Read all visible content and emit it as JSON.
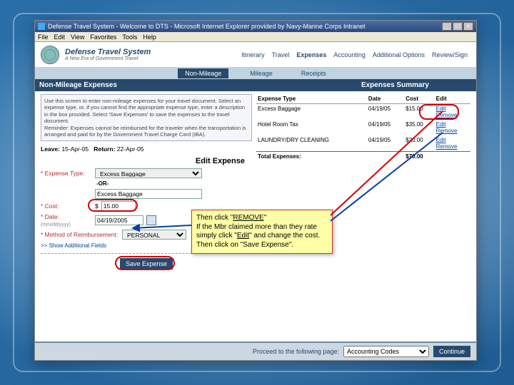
{
  "window": {
    "title": "Defense Travel System - Welcome to DTS - Microsoft Internet Explorer provided by Navy-Marine Corps Intranet",
    "min": "_",
    "max": "□",
    "close": "×"
  },
  "menu": {
    "file": "File",
    "edit": "Edit",
    "view": "View",
    "fav": "Favorites",
    "tools": "Tools",
    "help": "Help"
  },
  "brand": {
    "title": "Defense Travel System",
    "sub": "A New Era of Government Travel"
  },
  "tabs": {
    "itin": "Itinerary",
    "travel": "Travel",
    "expenses": "Expenses",
    "acct": "Accounting",
    "addl": "Additional Options",
    "review": "Review/Sign"
  },
  "subtabs": {
    "nm": "Non-Mileage",
    "mi": "Mileage",
    "rc": "Receipts"
  },
  "section": {
    "left": "Non-Mileage Expenses",
    "right": "Expenses Summary"
  },
  "instr": "Use this screen to enter non-mileage expenses for your travel document. Select an expense type, or, if you cannot find the appropriate expense type, enter a description in the box provided. Select 'Save Expenses' to save the expenses to the travel document.\nReminder: Expenses cannot be reimbursed for the traveler when the transportation is arranged and paid for by the Government Travel Charge Card (IBA).",
  "lr": {
    "leave_l": "Leave:",
    "leave_d": "15-Apr-05",
    "ret_l": "Return:",
    "ret_d": "22-Apr-05"
  },
  "editexp": "Edit Expense",
  "form": {
    "type_l": "* Expense Type:",
    "type_v": "Excess Baggage",
    "or": "-OR-",
    "desc_v": "Excess Baggage",
    "cost_l": "* Cost:",
    "cost_v": "15.00",
    "date_l": "* Date:",
    "date_hint": "(mm/dd/yyyy)",
    "date_v": "04/19/2005",
    "mor_l": "* Method of Reimbursement:",
    "mor_v": "PERSONAL",
    "more": ">> Show Additional Fields",
    "save": "Save Expense"
  },
  "summary": {
    "h1": "Expense Type",
    "h2": "Date",
    "h3": "Cost",
    "h4": "Edit",
    "rows": [
      {
        "t": "Excess Baggage",
        "d": "04/19/05",
        "c": "$15.00",
        "e": "Edit",
        "r": "Remove"
      },
      {
        "t": "Hotel Room Tax",
        "d": "04/19/05",
        "c": "$35.00",
        "e": "Edit",
        "r": "Remove"
      },
      {
        "t": "LAUNDRY/DRY CLEANING",
        "d": "04/19/05",
        "c": "$20.00",
        "e": "Edit",
        "r": "Remove"
      }
    ],
    "tot_l": "Total Expenses:",
    "tot_v": "$70.00"
  },
  "footer": {
    "proc": "Proceed to the following page:",
    "sel": "Accounting Codes",
    "cont": "Continue"
  },
  "callout": {
    "l1a": "Then click \"",
    "l1b": "REMOVE",
    "l1c": "\"",
    "l2": "If the Mbr claimed more than they rate simply click \"",
    "l2b": "Edit",
    "l2c": "\" and change the cost.  Then click on \"Save Expense\"."
  }
}
